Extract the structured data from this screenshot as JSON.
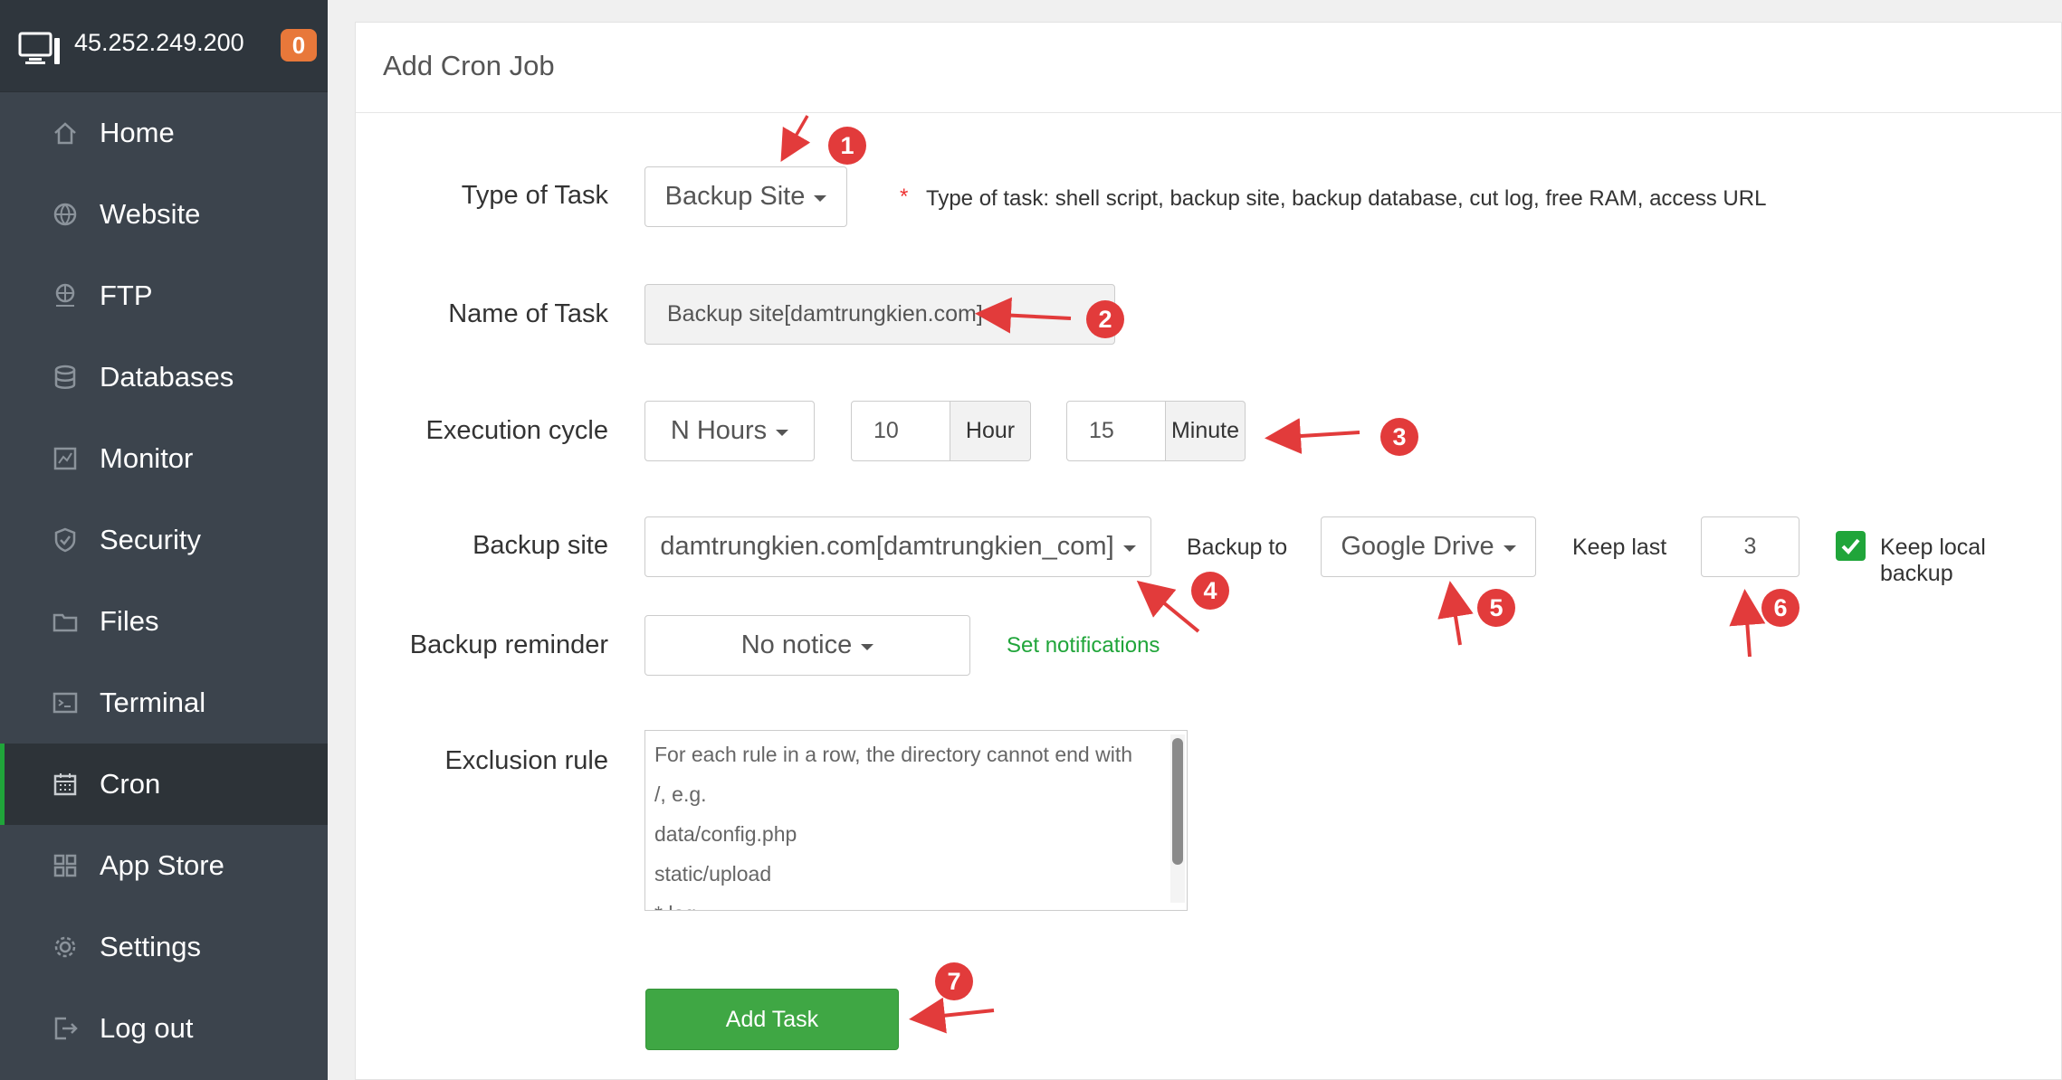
{
  "header": {
    "ip": "45.252.249.200",
    "badge_count": "0"
  },
  "sidebar": {
    "items": [
      {
        "label": "Home",
        "icon": "home-icon"
      },
      {
        "label": "Website",
        "icon": "globe-icon"
      },
      {
        "label": "FTP",
        "icon": "ftp-icon"
      },
      {
        "label": "Databases",
        "icon": "database-icon"
      },
      {
        "label": "Monitor",
        "icon": "monitor-chart-icon"
      },
      {
        "label": "Security",
        "icon": "shield-icon"
      },
      {
        "label": "Files",
        "icon": "folder-icon"
      },
      {
        "label": "Terminal",
        "icon": "terminal-icon"
      },
      {
        "label": "Cron",
        "icon": "calendar-icon",
        "active": true
      },
      {
        "label": "App Store",
        "icon": "grid-icon"
      },
      {
        "label": "Settings",
        "icon": "gear-icon"
      },
      {
        "label": "Log out",
        "icon": "logout-icon"
      }
    ]
  },
  "page": {
    "title": "Add Cron Job"
  },
  "form": {
    "type_of_task": {
      "label": "Type of Task",
      "value": "Backup Site",
      "hint_star": "*",
      "hint": "Type of task: shell script, backup site, backup database, cut log, free RAM, access URL"
    },
    "name_of_task": {
      "label": "Name of Task",
      "value": "Backup site[damtrungkien.com]"
    },
    "execution_cycle": {
      "label": "Execution cycle",
      "cycle": "N Hours",
      "hour_value": "10",
      "hour_unit": "Hour",
      "minute_value": "15",
      "minute_unit": "Minute"
    },
    "backup_site": {
      "label": "Backup site",
      "value": "damtrungkien.com[damtrungkien_com]",
      "backup_to_label": "Backup to",
      "backup_to": "Google Drive",
      "keep_last_label": "Keep last",
      "keep_last": "3",
      "keep_local_label": "Keep local backup",
      "keep_local_checked": true
    },
    "backup_reminder": {
      "label": "Backup reminder",
      "value": "No notice",
      "set_notifications": "Set notifications"
    },
    "exclusion_rule": {
      "label": "Exclusion rule",
      "lines": [
        "For each rule in a row, the directory cannot end with",
        "/, e.g.",
        "data/config.php",
        "static/upload",
        "*.log"
      ]
    },
    "submit_label": "Add Task"
  },
  "annotations": [
    "1",
    "2",
    "3",
    "4",
    "5",
    "6",
    "7"
  ],
  "colors": {
    "sidebar_bg": "#3c444d",
    "accent_green": "#20a53a",
    "button_green": "#3fa744",
    "badge_orange": "#e8783a",
    "marker_red": "#e23b3b"
  }
}
